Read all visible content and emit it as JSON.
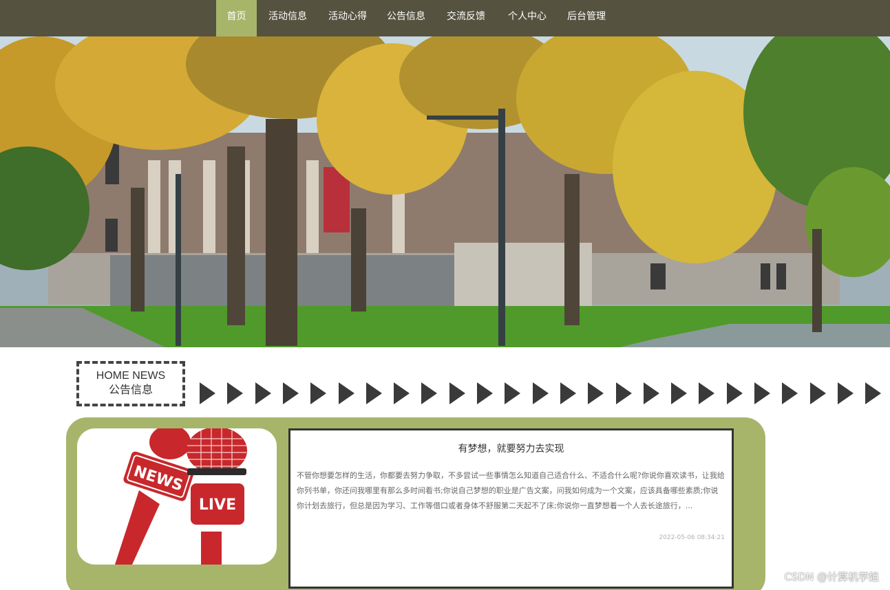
{
  "nav": {
    "items": [
      {
        "label": "首页",
        "active": true
      },
      {
        "label": "活动信息"
      },
      {
        "label": "活动心得"
      },
      {
        "label": "公告信息"
      },
      {
        "label": "交流反馈"
      },
      {
        "label": "个人中心"
      },
      {
        "label": "后台管理"
      }
    ]
  },
  "banner": {
    "image": "campus-autumn-library-photo",
    "slider_dots": 3,
    "active_slide": 2
  },
  "section": {
    "title_en": "HOME NEWS",
    "title_cn": "公告信息",
    "decoration": "arrow-right-icon-row"
  },
  "news": {
    "image": "news-live-microphones-illustration",
    "image_text_news": "NEWS",
    "image_text_live": "LIVE",
    "title": "有梦想，就要努力去实现",
    "summary": "不管你想要怎样的生活，你都要去努力争取，不多尝试一些事情怎么知道自己适合什么、不适合什么呢?你说你喜欢读书，让我给你列书单，你还问我哪里有那么多时间看书;你说自己梦想的职业是广告文案，问我如何成为一个文案，应该具备哪些素质;你说你计划去旅行，但总是因为学习、工作等借口或者身体不舒服第二天起不了床;你说你一直梦想着一个人去长途旅行，...",
    "time": "2022-05-06 08:34:21"
  },
  "colors": {
    "nav_bg": "#55523f",
    "accent": "#a7b56b",
    "mic_red": "#c8282c"
  },
  "watermark": "CSDN @计算机学姐"
}
